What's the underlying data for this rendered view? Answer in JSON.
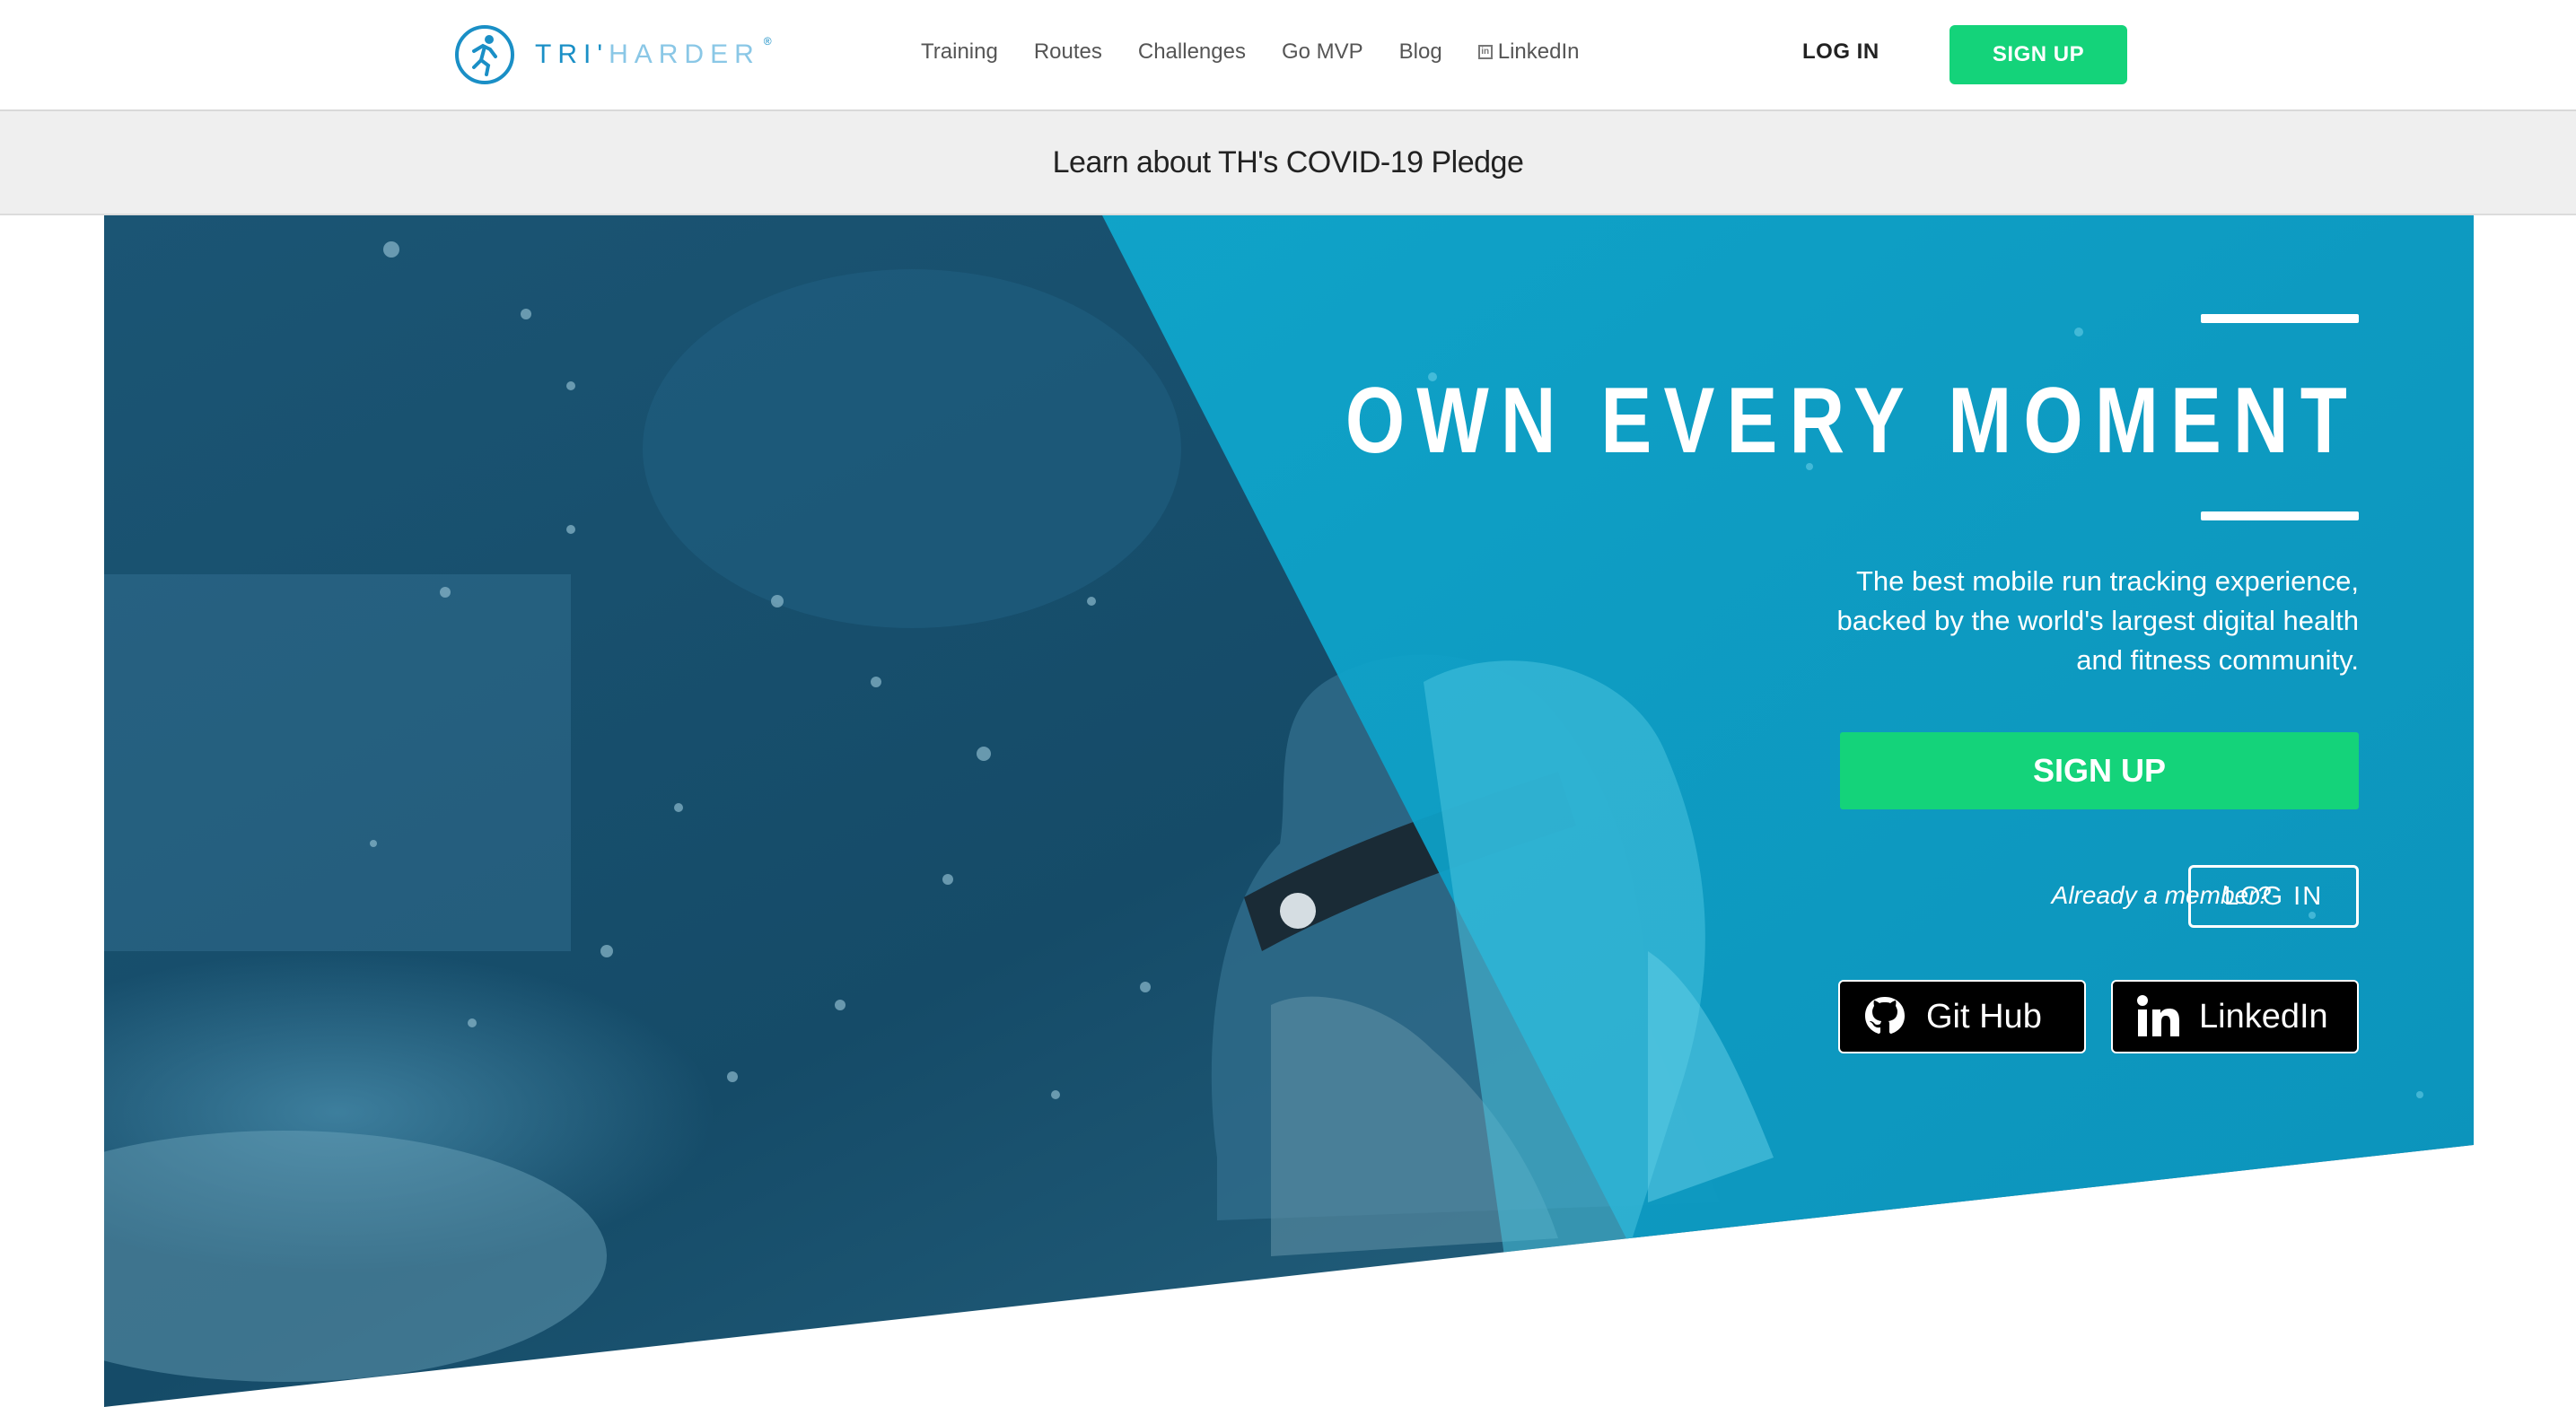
{
  "header": {
    "logo_primary": "TRI'",
    "logo_secondary": "HARDER",
    "logo_reg": "®",
    "nav": [
      "Training",
      "Routes",
      "Challenges",
      "Go MVP",
      "Blog",
      "LinkedIn"
    ],
    "login_label": "LOG IN",
    "signup_label": "SIGN UP"
  },
  "banner": {
    "text": "Learn about TH's COVID-19 Pledge"
  },
  "hero": {
    "title": "OWN EVERY MOMENT",
    "copy": "The best mobile run tracking experience, backed by the world's largest digital health and fitness community.",
    "signup_label": "SIGN UP",
    "member_text": "Already a member?",
    "login_label": "LOG IN",
    "github_label": "Git Hub",
    "linkedin_label": "LinkedIn"
  },
  "colors": {
    "accent_green": "#14d37a",
    "brand_blue": "#1a8fc6",
    "hero_teal": "#0aa0c8",
    "hero_dark": "#134a66"
  },
  "icons": [
    "runner-logo-icon",
    "linkedin-mini-icon",
    "github-icon",
    "linkedin-icon"
  ]
}
